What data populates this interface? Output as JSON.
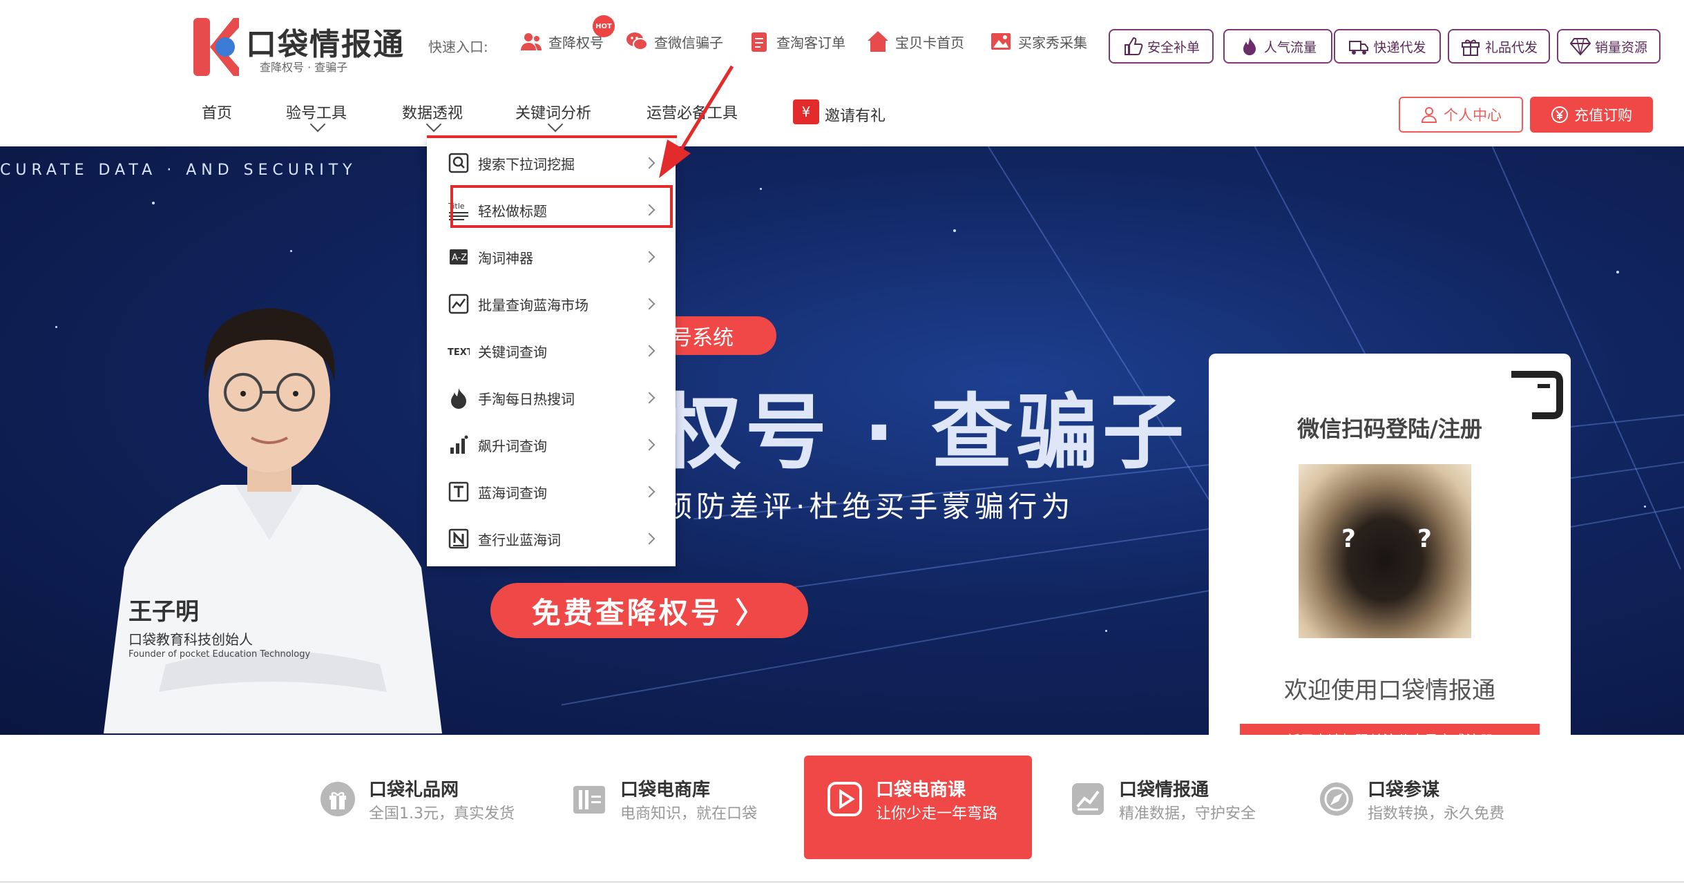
{
  "brand": {
    "name": "口袋情报通",
    "tagline": "查降权号 · 查骗子"
  },
  "quick": {
    "label": "快速入口:",
    "hot_badge": "HOT",
    "links": [
      "查降权号",
      "查微信骗子",
      "查淘客订单",
      "宝贝卡首页",
      "买家秀采集"
    ],
    "pills": [
      "安全补单",
      "人气流量",
      "快递代发",
      "礼品代发",
      "销量资源"
    ]
  },
  "nav": {
    "items": [
      "首页",
      "验号工具",
      "数据透视",
      "关键词分析",
      "运营必备工具",
      "邀请有礼"
    ],
    "user_center": "个人中心",
    "recharge": "充值订购"
  },
  "dropdown": {
    "items": [
      "搜索下拉词挖掘",
      "轻松做标题",
      "淘词神器",
      "批量查询蓝海市场",
      "关键词查询",
      "手淘每日热搜词",
      "飙升词查询",
      "蓝海词查询",
      "查行业蓝海词"
    ]
  },
  "banner": {
    "tagline": "CURATE DATA  · AND SECURITY",
    "red_tab": "号系统",
    "headline": "权号 · 查骗子",
    "subline": "预防差评·杜绝买手蒙骗行为",
    "cta": "免费查降权号 〉",
    "person": {
      "name": "王子明",
      "role": "口袋教育科技创始人",
      "role_en": "Founder of pocket Education Technology"
    }
  },
  "login": {
    "title": "微信扫码登陆/注册",
    "welcome": "欢迎使用口袋情报通",
    "register_button": "新用户请扫码关注公众号完成注册"
  },
  "bottom": {
    "items": [
      {
        "title": "口袋礼品网",
        "desc": "全国1.3元，真实发货",
        "icon": "gift-icon"
      },
      {
        "title": "口袋电商库",
        "desc": "电商知识，就在口袋",
        "icon": "library-icon"
      },
      {
        "title": "口袋电商课",
        "desc": "让你少走一年弯路",
        "icon": "play-icon"
      },
      {
        "title": "口袋情报通",
        "desc": "精准数据，守护安全",
        "icon": "chart-icon"
      },
      {
        "title": "口袋参谋",
        "desc": "指数转换，永久免费",
        "icon": "compass-icon"
      }
    ]
  },
  "colors": {
    "brand_red": "#f04747",
    "banner_navy": "#10245e",
    "pill_purple": "#7a3a76",
    "highlight_red": "#e32b2b"
  }
}
